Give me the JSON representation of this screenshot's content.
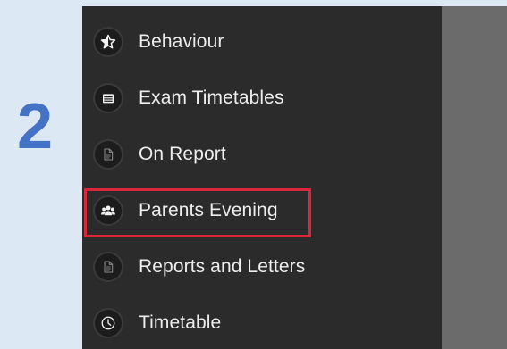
{
  "step": {
    "number": "2"
  },
  "menu": {
    "items": [
      {
        "label": "Behaviour",
        "icon": "star-half-icon"
      },
      {
        "label": "Exam Timetables",
        "icon": "table-icon"
      },
      {
        "label": "On Report",
        "icon": "document-icon"
      },
      {
        "label": "Parents Evening",
        "icon": "people-icon",
        "highlighted": true
      },
      {
        "label": "Reports and Letters",
        "icon": "document-icon"
      },
      {
        "label": "Timetable",
        "icon": "clock-icon"
      }
    ]
  },
  "colors": {
    "step_number": "#4472c4",
    "menu_background": "#2b2b2b",
    "content_background": "#6b6b6b",
    "highlight_border": "#d9263a",
    "label_text": "#ededed"
  }
}
